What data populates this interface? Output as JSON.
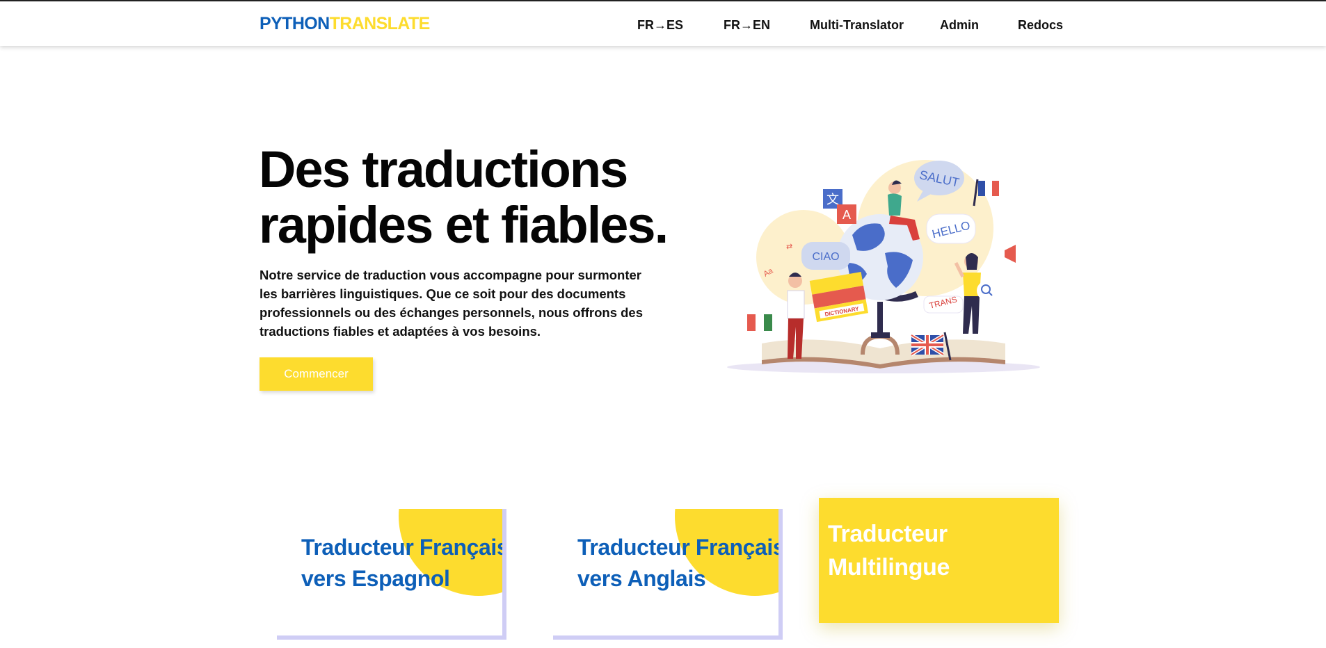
{
  "brand": {
    "part1": "PYTHON",
    "part2": "TRANSLATE"
  },
  "nav": {
    "links": [
      {
        "label": "FR→ES"
      },
      {
        "label": "FR→EN"
      },
      {
        "label": "Multi-Translator"
      },
      {
        "label": "Admin"
      },
      {
        "label": "Redocs"
      }
    ]
  },
  "hero": {
    "title_line1": "Des traductions",
    "title_line2": "rapides et fiables.",
    "description": "Notre service de traduction vous accompagne pour surmonter les barrières linguistiques. Que ce soit pour des documents professionnels ou des échanges personnels, nous offrons des traductions fiables et adaptées à vos besoins.",
    "cta_label": "Commencer"
  },
  "illustration": {
    "bubbles": [
      "SALUT",
      "HELLO",
      "CIAO",
      "TRANS"
    ],
    "book_label": "DICTIONARY",
    "icons": [
      "translate-icon",
      "globe-icon",
      "megaphone-icon",
      "magnifier-icon",
      "flag-france-icon",
      "flag-italy-icon",
      "flag-uk-icon"
    ]
  },
  "cards": [
    {
      "line1": "Traducteur Français",
      "line2": "vers Espagnol"
    },
    {
      "line1": "Traducteur Français",
      "line2": "vers Anglais"
    },
    {
      "line1": "Traducteur",
      "line2": "Multilingue"
    }
  ],
  "colors": {
    "brand_blue": "#0d5fb8",
    "accent_yellow": "#fddc2e",
    "card_shadow_lavender": "#cfcdf5"
  }
}
